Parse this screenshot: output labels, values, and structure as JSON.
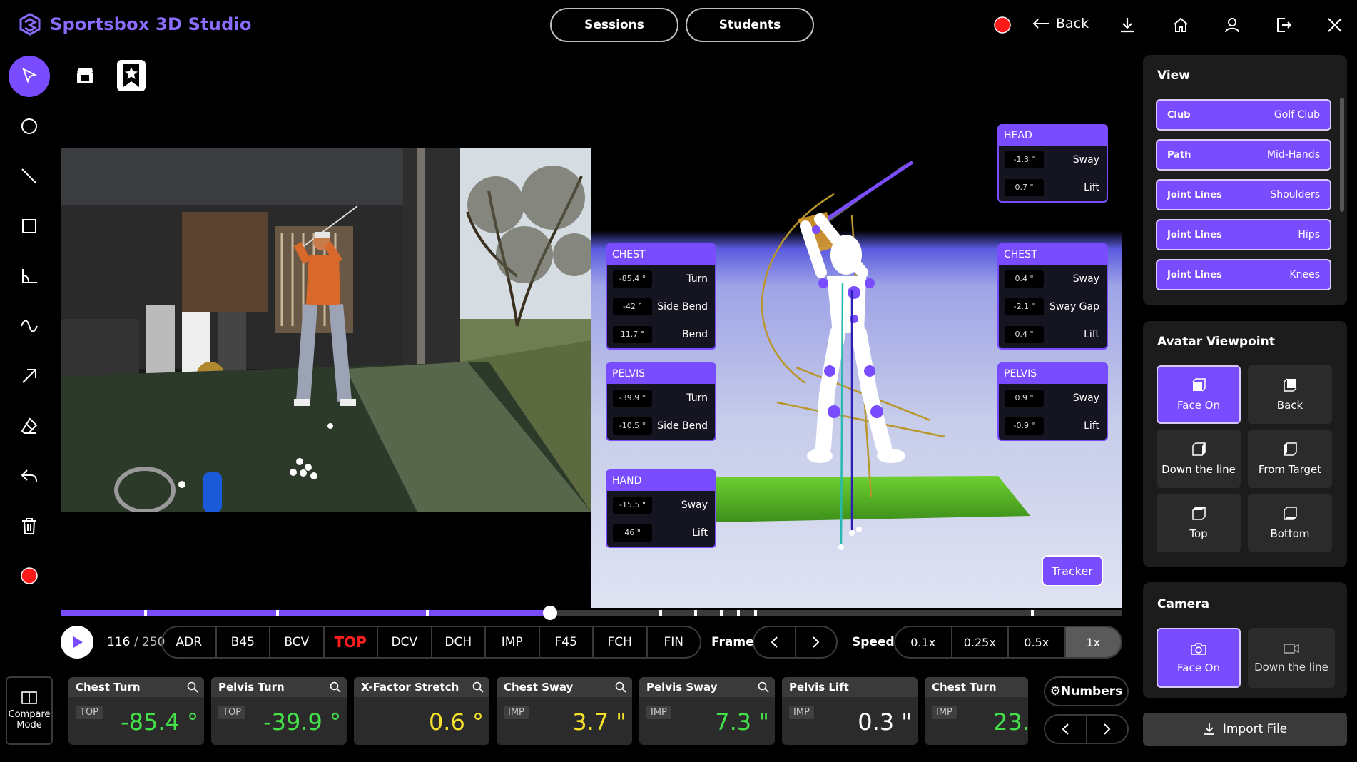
{
  "app": {
    "title": "Sportsbox 3D Studio"
  },
  "header": {
    "sessions_label": "Sessions",
    "students_label": "Students",
    "back_label": "Back"
  },
  "colors": {
    "accent": "#7a4cff",
    "green_value": "#44e04a",
    "yellow_value": "#f4e02a",
    "record": "#ff1a1a"
  },
  "tools": [
    "select",
    "circle",
    "line",
    "rectangle",
    "angle",
    "curve",
    "arrow",
    "eraser",
    "undo",
    "delete",
    "record"
  ],
  "joints": {
    "head": {
      "title": "HEAD",
      "rows": [
        {
          "value": "-1.3 \"",
          "label": "Sway"
        },
        {
          "value": "0.7 \"",
          "label": "Lift"
        }
      ]
    },
    "chest_left": {
      "title": "CHEST",
      "rows": [
        {
          "value": "-85.4 °",
          "label": "Turn"
        },
        {
          "value": "-42 °",
          "label": "Side Bend"
        },
        {
          "value": "11.7 °",
          "label": "Bend"
        }
      ]
    },
    "pelvis_left": {
      "title": "PELVIS",
      "rows": [
        {
          "value": "-39.9 °",
          "label": "Turn"
        },
        {
          "value": "-10.5 °",
          "label": "Side Bend"
        }
      ]
    },
    "hand": {
      "title": "HAND",
      "rows": [
        {
          "value": "-15.5 \"",
          "label": "Sway"
        },
        {
          "value": "46 \"",
          "label": "Lift"
        }
      ]
    },
    "chest_right": {
      "title": "CHEST",
      "rows": [
        {
          "value": "0.4 \"",
          "label": "Sway"
        },
        {
          "value": "-2.1 \"",
          "label": "Sway Gap"
        },
        {
          "value": "0.4 \"",
          "label": "Lift"
        }
      ]
    },
    "pelvis_right": {
      "title": "PELVIS",
      "rows": [
        {
          "value": "0.9 \"",
          "label": "Sway"
        },
        {
          "value": "-0.9 \"",
          "label": "Lift"
        }
      ]
    }
  },
  "tracker_label": "Tracker",
  "view_panel": {
    "title": "View",
    "items": [
      {
        "key": "Club",
        "value": "Golf Club"
      },
      {
        "key": "Path",
        "value": "Mid-Hands"
      },
      {
        "key": "Joint Lines",
        "value": "Shoulders"
      },
      {
        "key": "Joint Lines",
        "value": "Hips"
      },
      {
        "key": "Joint Lines",
        "value": "Knees"
      }
    ]
  },
  "avatar_viewpoint": {
    "title": "Avatar Viewpoint",
    "options": [
      "Face On",
      "Back",
      "Down the line",
      "From Target",
      "Top",
      "Bottom"
    ],
    "selected": "Face On"
  },
  "camera": {
    "title": "Camera",
    "options": [
      "Face On",
      "Down the line"
    ],
    "selected": "Face On"
  },
  "import_label": "Import File",
  "timeline": {
    "current_frame": "116",
    "total_frames": "/ 250",
    "progress": 0.464
  },
  "phases": [
    "ADR",
    "B45",
    "BCV",
    "TOP",
    "DCV",
    "DCH",
    "IMP",
    "F45",
    "FCH",
    "FIN"
  ],
  "active_phase": "TOP",
  "frame_label": "Frame",
  "speed_label": "Speed",
  "speeds": [
    "0.1x",
    "0.25x",
    "0.5x",
    "1x"
  ],
  "active_speed": "1x",
  "compare_label": "Compare Mode",
  "numbers_label": "⚙Numbers",
  "metrics": [
    {
      "name": "Chest Turn",
      "phase": "TOP",
      "value": "-85.4 °",
      "color": "#44e04a"
    },
    {
      "name": "Pelvis Turn",
      "phase": "TOP",
      "value": "-39.9 °",
      "color": "#44e04a"
    },
    {
      "name": "X-Factor Stretch",
      "phase": "",
      "value": "0.6 °",
      "color": "#f4e02a"
    },
    {
      "name": "Chest Sway",
      "phase": "IMP",
      "value": "3.7 \"",
      "color": "#f4e02a"
    },
    {
      "name": "Pelvis Sway",
      "phase": "IMP",
      "value": "7.3 \"",
      "color": "#44e04a"
    },
    {
      "name": "Pelvis Lift",
      "phase": "IMP",
      "value": "0.3 \"",
      "color": "#ffffff"
    },
    {
      "name": "Chest Turn",
      "phase": "IMP",
      "value": "23.",
      "color": "#44e04a"
    }
  ]
}
